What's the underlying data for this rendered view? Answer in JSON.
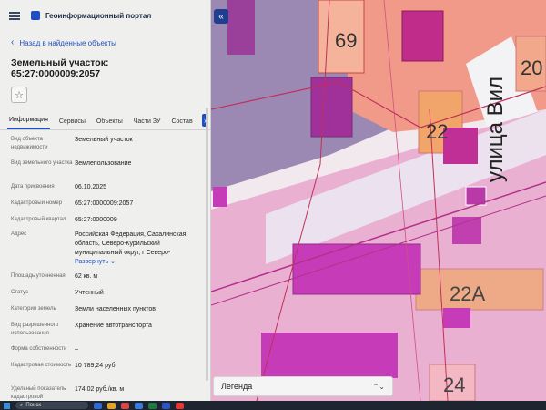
{
  "header": {
    "portal_title": "Геоинформационный портал"
  },
  "nav": {
    "back_label": "Назад в найденные объекты"
  },
  "object": {
    "title": "Земельный участок: 65:27:0000009:2057"
  },
  "tabs": [
    {
      "label": "Информация",
      "active": true
    },
    {
      "label": "Сервисы"
    },
    {
      "label": "Объекты"
    },
    {
      "label": "Части ЗУ"
    },
    {
      "label": "Состав"
    }
  ],
  "tabs_more": "›",
  "details": {
    "rows": [
      {
        "label": "Вид объекта недвижимости",
        "value": "Земельный участок"
      },
      {
        "label": "Вид земельного участка",
        "value": "Землепользование"
      },
      {
        "label": "Дата присвоения",
        "value": "06.10.2025"
      },
      {
        "label": "Кадастровый номер",
        "value": "65:27:0000009:2057"
      },
      {
        "label": "Кадастровый квартал",
        "value": "65:27:0000009"
      },
      {
        "label": "Адрес",
        "value": "Российская Федерация, Сахалинская область, Северо-Курильский муниципальный округ, г Северо-"
      },
      {
        "label": "Площадь уточненная",
        "value": "62 кв. м"
      },
      {
        "label": "Статус",
        "value": "Учтенный"
      },
      {
        "label": "Категория земель",
        "value": "Земли населенных пунктов"
      },
      {
        "label": "Вид разрешенного использования",
        "value": "Хранение автотранспорта"
      },
      {
        "label": "Форма собственности",
        "value": "–"
      },
      {
        "label": "Кадастровая стоимость",
        "value": "10 789,24 руб."
      },
      {
        "label": "Удельный показатель кадастровой",
        "value": "174,02 руб./кв. м"
      }
    ],
    "expand_label": "Развернуть"
  },
  "map": {
    "collapse_icon": "«",
    "labels": [
      "69",
      "22",
      "20",
      "22А",
      "24",
      "улица Вил"
    ],
    "legend_label": "Легенда",
    "legend_icon": "⌃⌄"
  },
  "taskbar": {
    "search_label": "Поиск"
  },
  "colors": {
    "accent": "#1f4fbf",
    "parcel_pink": "#e8a0c8",
    "parcel_magenta": "#c030b0",
    "parcel_orange": "#f2a56a"
  }
}
